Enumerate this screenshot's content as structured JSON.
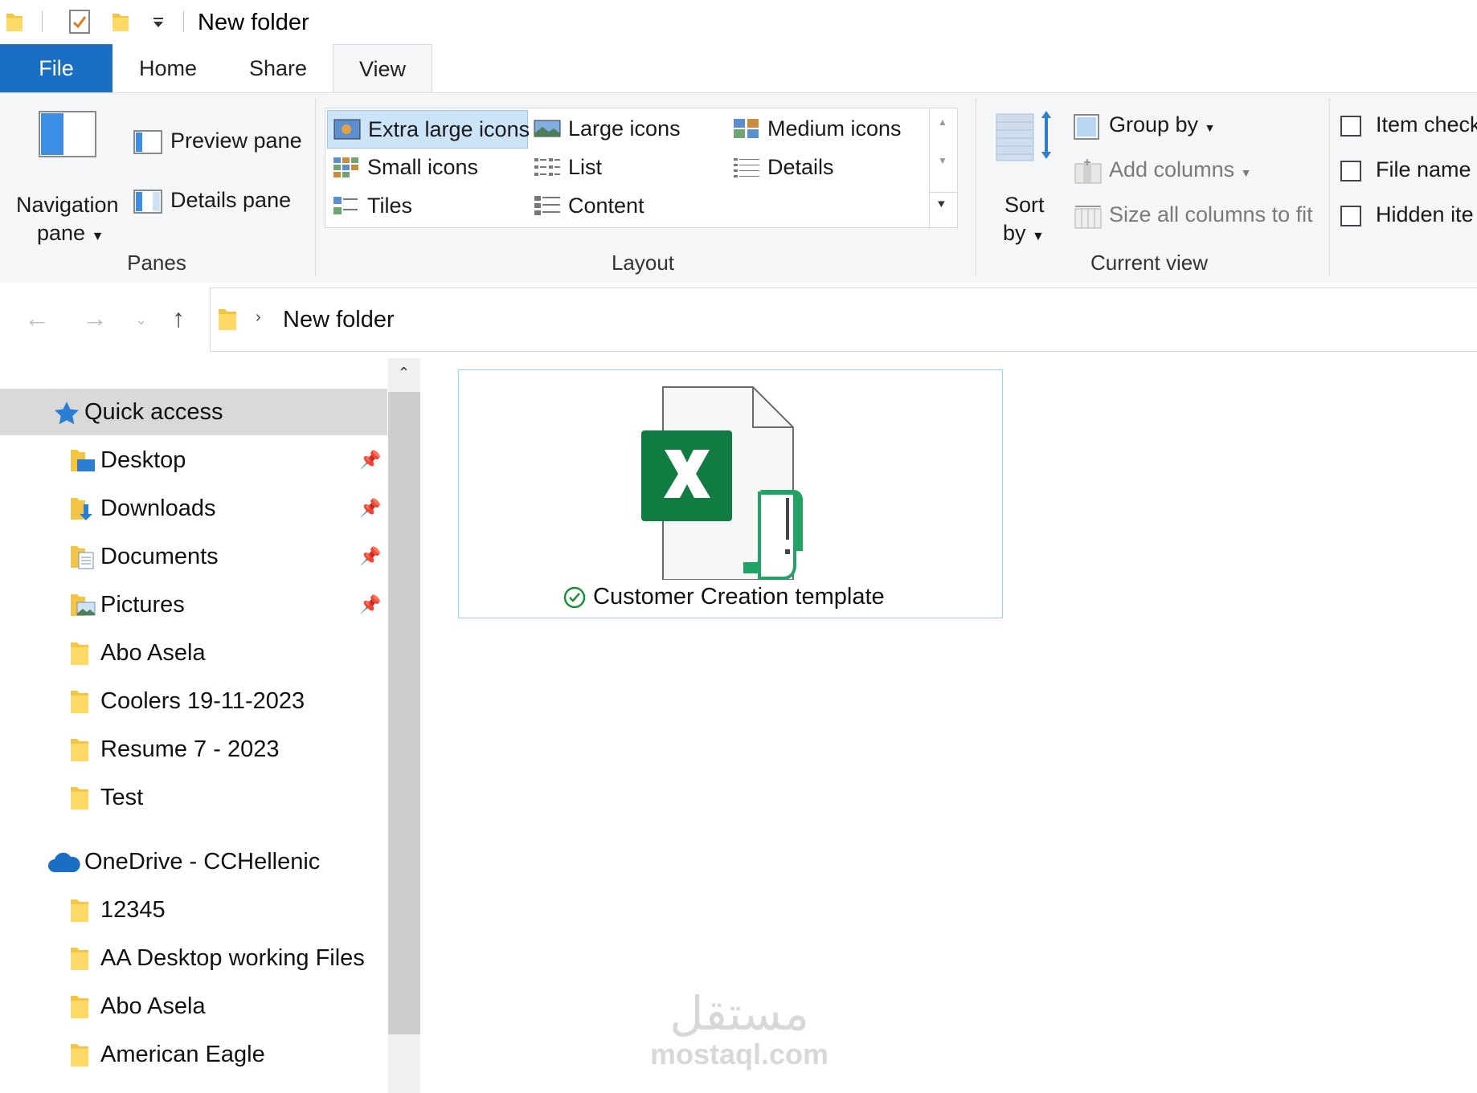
{
  "window": {
    "title": "New folder"
  },
  "quick_access_icons": [
    "folder-icon",
    "properties-check-icon",
    "new-folder-icon",
    "customize-dropdown-icon"
  ],
  "tabs": [
    {
      "label": "File"
    },
    {
      "label": "Home"
    },
    {
      "label": "Share"
    },
    {
      "label": "View",
      "active": true
    }
  ],
  "ribbon": {
    "panes": {
      "navigation_pane_line1": "Navigation",
      "navigation_pane_line2": "pane",
      "preview_pane": "Preview pane",
      "details_pane": "Details pane",
      "group_label": "Panes"
    },
    "layout": {
      "items": [
        {
          "label": "Extra large icons",
          "selected": true
        },
        {
          "label": "Large icons"
        },
        {
          "label": "Medium icons"
        },
        {
          "label": "Small icons"
        },
        {
          "label": "List"
        },
        {
          "label": "Details"
        },
        {
          "label": "Tiles"
        },
        {
          "label": "Content"
        }
      ],
      "group_label": "Layout"
    },
    "current_view": {
      "sort_line1": "Sort",
      "sort_line2": "by",
      "group_by": "Group by",
      "add_columns": "Add columns",
      "size_columns": "Size all columns to fit",
      "group_label": "Current view"
    },
    "show_hide": {
      "item_check": "Item check",
      "file_name_ext": "File name e",
      "hidden_items": "Hidden ite"
    }
  },
  "address": {
    "crumb": "New folder"
  },
  "nav_tree": {
    "quick_access": "Quick access",
    "quick_items": [
      {
        "label": "Desktop",
        "pinned": true
      },
      {
        "label": "Downloads",
        "pinned": true
      },
      {
        "label": "Documents",
        "pinned": true
      },
      {
        "label": "Pictures",
        "pinned": true
      },
      {
        "label": "Abo Asela"
      },
      {
        "label": "Coolers 19-11-2023"
      },
      {
        "label": "Resume 7 - 2023"
      },
      {
        "label": "Test"
      }
    ],
    "onedrive": "OneDrive - CCHellenic",
    "onedrive_items": [
      {
        "label": "12345"
      },
      {
        "label": "AA Desktop working Files"
      },
      {
        "label": "Abo Asela"
      },
      {
        "label": "American Eagle"
      }
    ]
  },
  "files": [
    {
      "name": "Customer Creation template",
      "status": "synced"
    }
  ],
  "watermark": {
    "arabic": "مستقل",
    "latin": "mostaql.com"
  },
  "colors": {
    "accent": "#1a6fc4",
    "excel_green": "#107c41",
    "selection": "#cce4f7",
    "folder": "#f4c543"
  }
}
